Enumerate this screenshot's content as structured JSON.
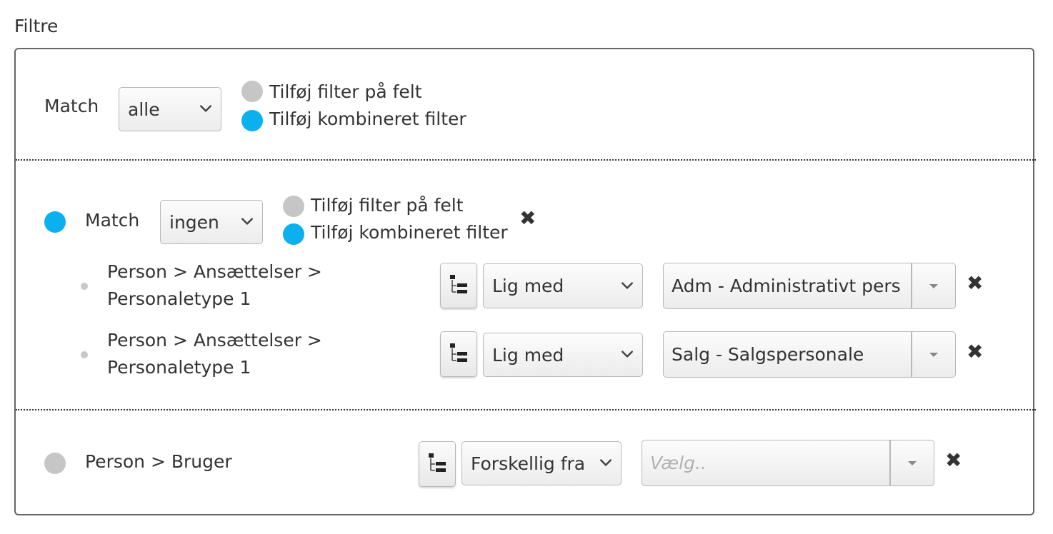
{
  "title": "Filtre",
  "root": {
    "match_label": "Match",
    "match_value": "alle",
    "add_field_filter": "Tilføj filter på felt",
    "add_combined_filter": "Tilføj kombineret filter"
  },
  "group": {
    "match_label": "Match",
    "match_value": "ingen",
    "add_field_filter": "Tilføj filter på felt",
    "add_combined_filter": "Tilføj kombineret filter",
    "conditions": [
      {
        "path_line1": "Person > Ansættelser >",
        "path_line2": "Personaletype 1",
        "operator": "Lig med",
        "value": "Adm - Administrativt pers"
      },
      {
        "path_line1": "Person > Ansættelser >",
        "path_line2": "Personaletype 1",
        "operator": "Lig med",
        "value": "Salg - Salgspersonale"
      }
    ]
  },
  "field_filter": {
    "path": "Person > Bruger",
    "operator": "Forskellig fra",
    "value_placeholder": "Vælg.."
  },
  "colors": {
    "blue_dot": "#0bb0ef",
    "grey_dot": "#c6c6c6"
  },
  "icons": {
    "remove": "close-icon",
    "tree": "tree-structure-icon",
    "chevron": "chevron-down-icon",
    "caret": "caret-down-icon"
  }
}
